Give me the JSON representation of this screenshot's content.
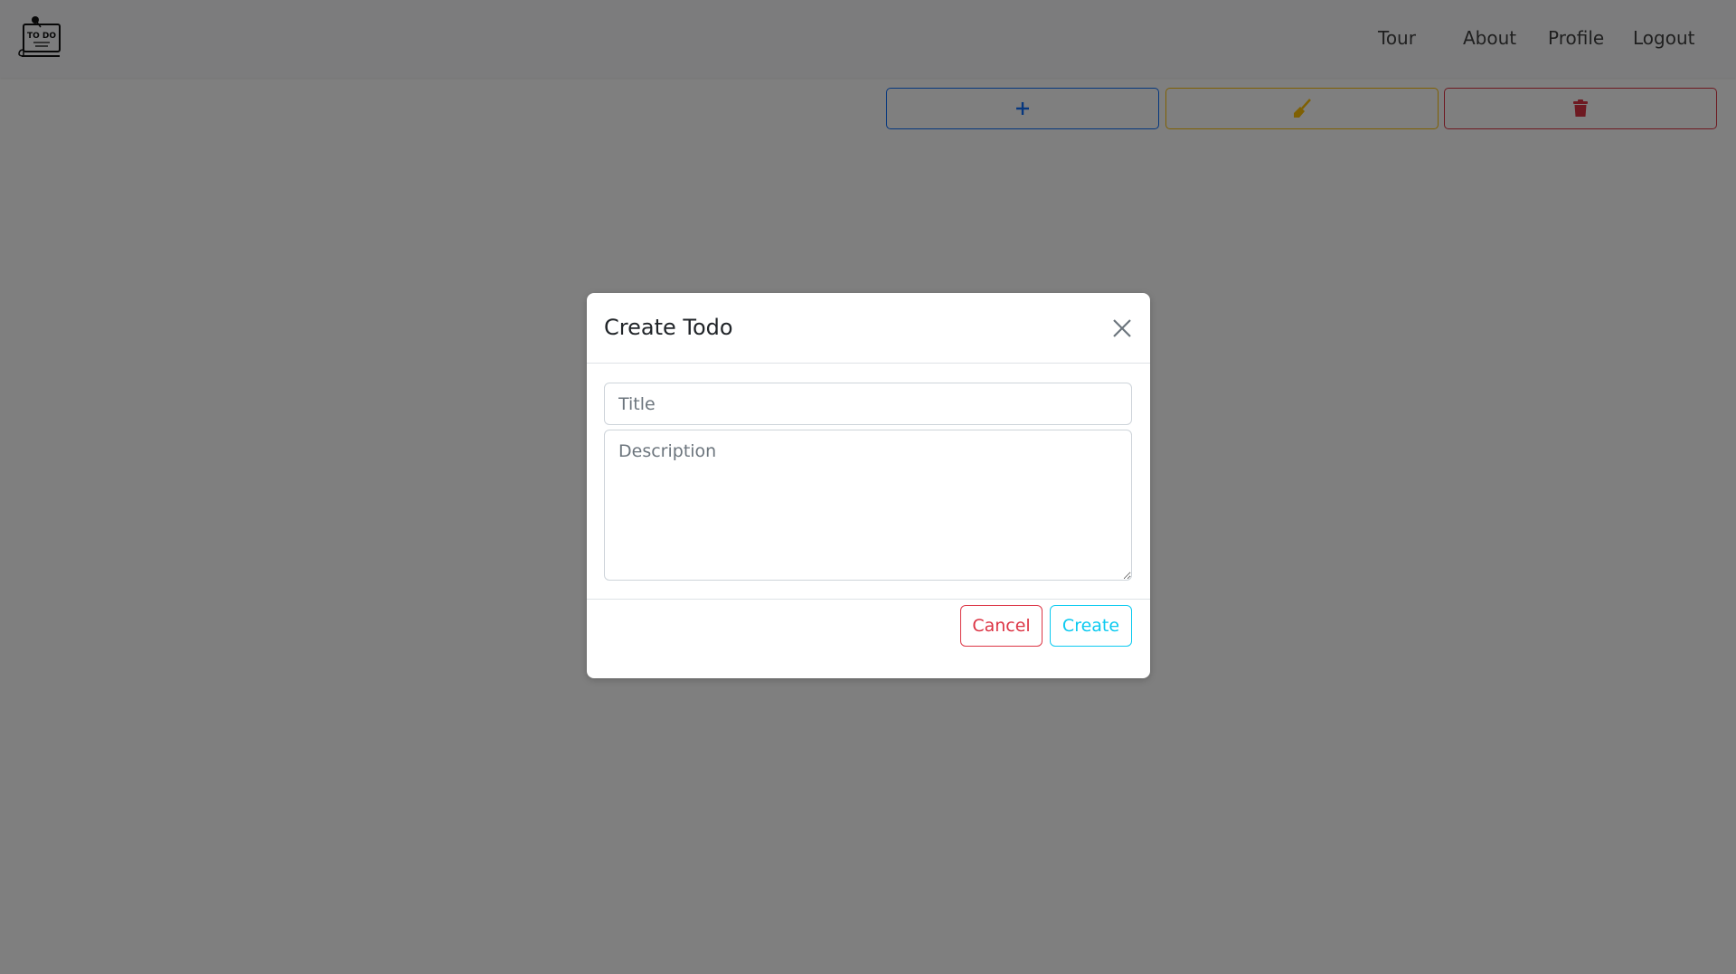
{
  "navbar": {
    "logo_text": "TO DO",
    "links": [
      {
        "label": "Tour"
      },
      {
        "label": "About"
      },
      {
        "label": "Profile"
      },
      {
        "label": "Logout"
      }
    ]
  },
  "toolbar": {
    "add_icon": "plus-icon",
    "clean_icon": "broom-icon",
    "delete_icon": "trash-icon",
    "colors": {
      "add": "#0d6efd",
      "clean": "#ffc107",
      "delete": "#dc3545"
    }
  },
  "modal": {
    "title": "Create Todo",
    "title_placeholder": "Title",
    "description_placeholder": "Description",
    "cancel_label": "Cancel",
    "create_label": "Create",
    "colors": {
      "cancel": "#dc3545",
      "create": "#0dcaf0"
    }
  }
}
